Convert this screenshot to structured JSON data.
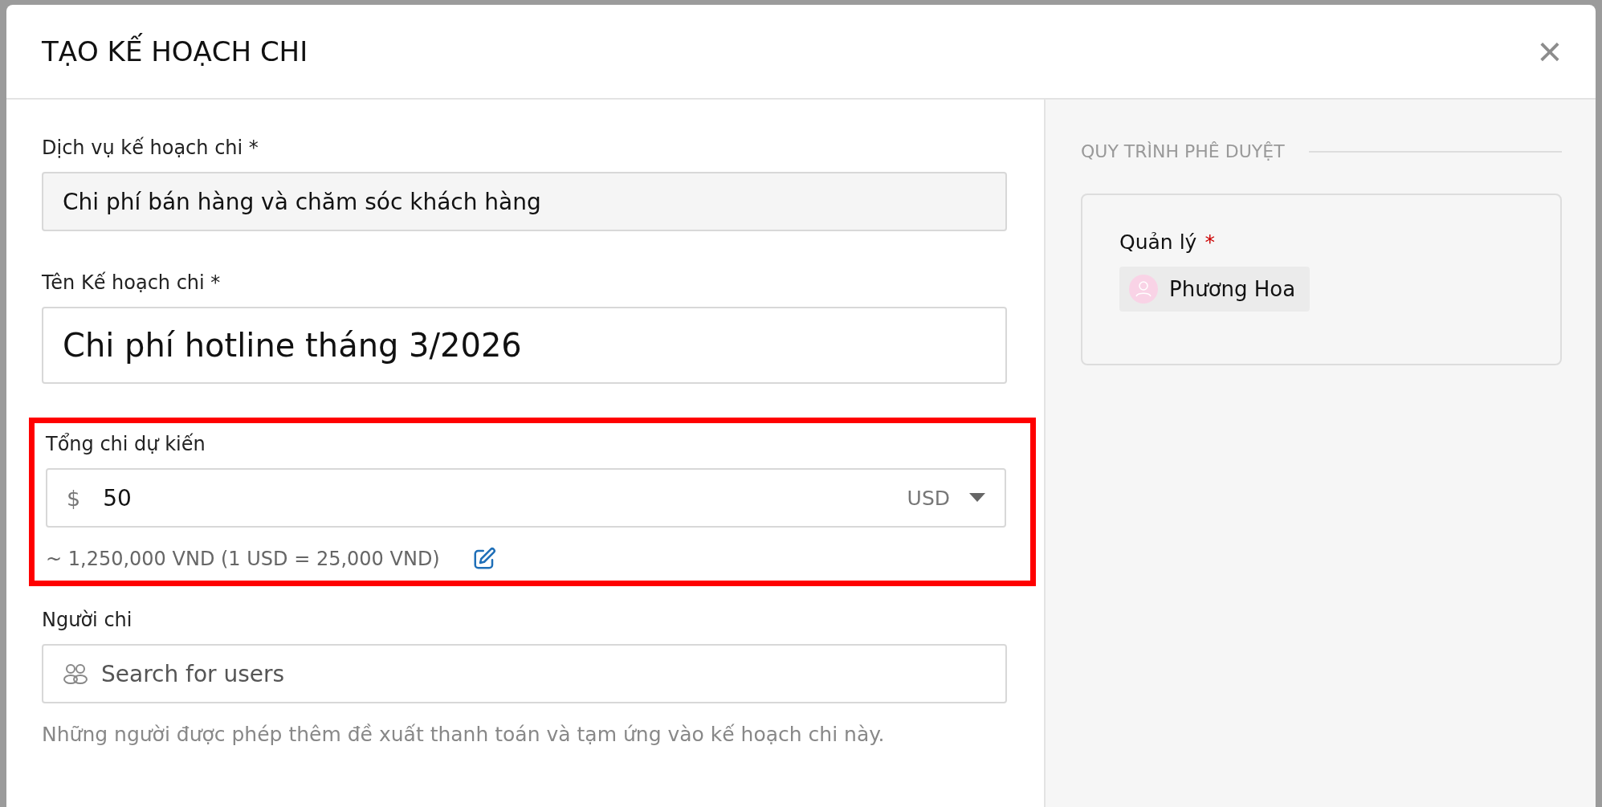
{
  "dialog": {
    "title": "TẠO KẾ HOẠCH CHI",
    "close": "×"
  },
  "form": {
    "service": {
      "label": "Dịch vụ kế hoạch chi *",
      "value": "Chi phí bán hàng và chăm sóc khách hàng"
    },
    "name": {
      "label": "Tên Kế hoạch chi *",
      "value": "Chi phí hotline tháng 3/2026"
    },
    "amount": {
      "label": "Tổng chi dự kiến",
      "symbol": "$",
      "value": "50",
      "currency": "USD",
      "conversion": "~ 1,250,000 VND (1 USD = 25,000 VND)",
      "highlighted": true
    },
    "spender": {
      "label": "Người chi",
      "placeholder": "Search for users",
      "help": "Những người được phép thêm đề xuất thanh toán và tạm ứng vào kế hoạch chi này."
    }
  },
  "approval": {
    "title": "QUY TRÌNH PHÊ DUYỆT",
    "role": "Quản lý",
    "required_mark": "*",
    "approvers": [
      {
        "name": "Phương Hoa",
        "color": "#f9d3e6"
      }
    ]
  }
}
